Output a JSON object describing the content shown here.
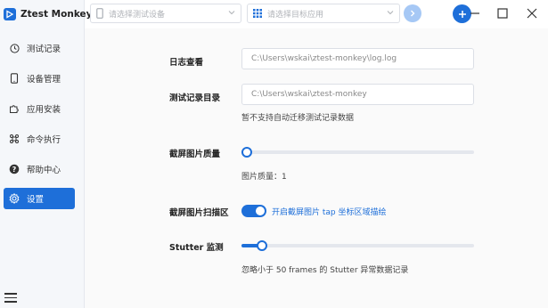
{
  "app": {
    "title": "Ztest Monkey"
  },
  "sidebar": {
    "items": [
      {
        "label": "测试记录",
        "icon": "clock-icon",
        "active": false
      },
      {
        "label": "设备管理",
        "icon": "phone-icon",
        "active": false
      },
      {
        "label": "应用安装",
        "icon": "puzzle-icon",
        "active": false
      },
      {
        "label": "命令执行",
        "icon": "command-icon",
        "active": false
      },
      {
        "label": "帮助中心",
        "icon": "help-icon",
        "active": false
      },
      {
        "label": "设置",
        "icon": "gear-icon",
        "active": true
      }
    ]
  },
  "topbar": {
    "device_select_placeholder": "请选择测试设备",
    "app_select_placeholder": "请选择目标应用"
  },
  "settings": {
    "log_view": {
      "label": "日志查看",
      "value": "C:\\Users\\wskai\\ztest-monkey\\log.log"
    },
    "record_dir": {
      "label": "测试记录目录",
      "value": "C:\\Users\\wskai\\ztest-monkey",
      "note": "暂不支持自动迁移测试记录数据"
    },
    "screenshot_quality": {
      "label": "截屏图片质量",
      "value": 1,
      "fill_fraction": 0.0,
      "hint": "图片质量：1"
    },
    "screenshot_scan": {
      "label": "截屏图片扫描区",
      "enabled": true,
      "toggle_text": "开启截屏图片 tap 坐标区域描绘"
    },
    "stutter": {
      "label": "Stutter 监测",
      "fill_fraction": 0.09,
      "hint": "忽略小于 50 frames 的 Stutter 异常数据记录"
    }
  },
  "colors": {
    "accent": "#1e6fd9",
    "sidebar_bg": "#f5f7fa",
    "content_bg": "#fafafa"
  }
}
